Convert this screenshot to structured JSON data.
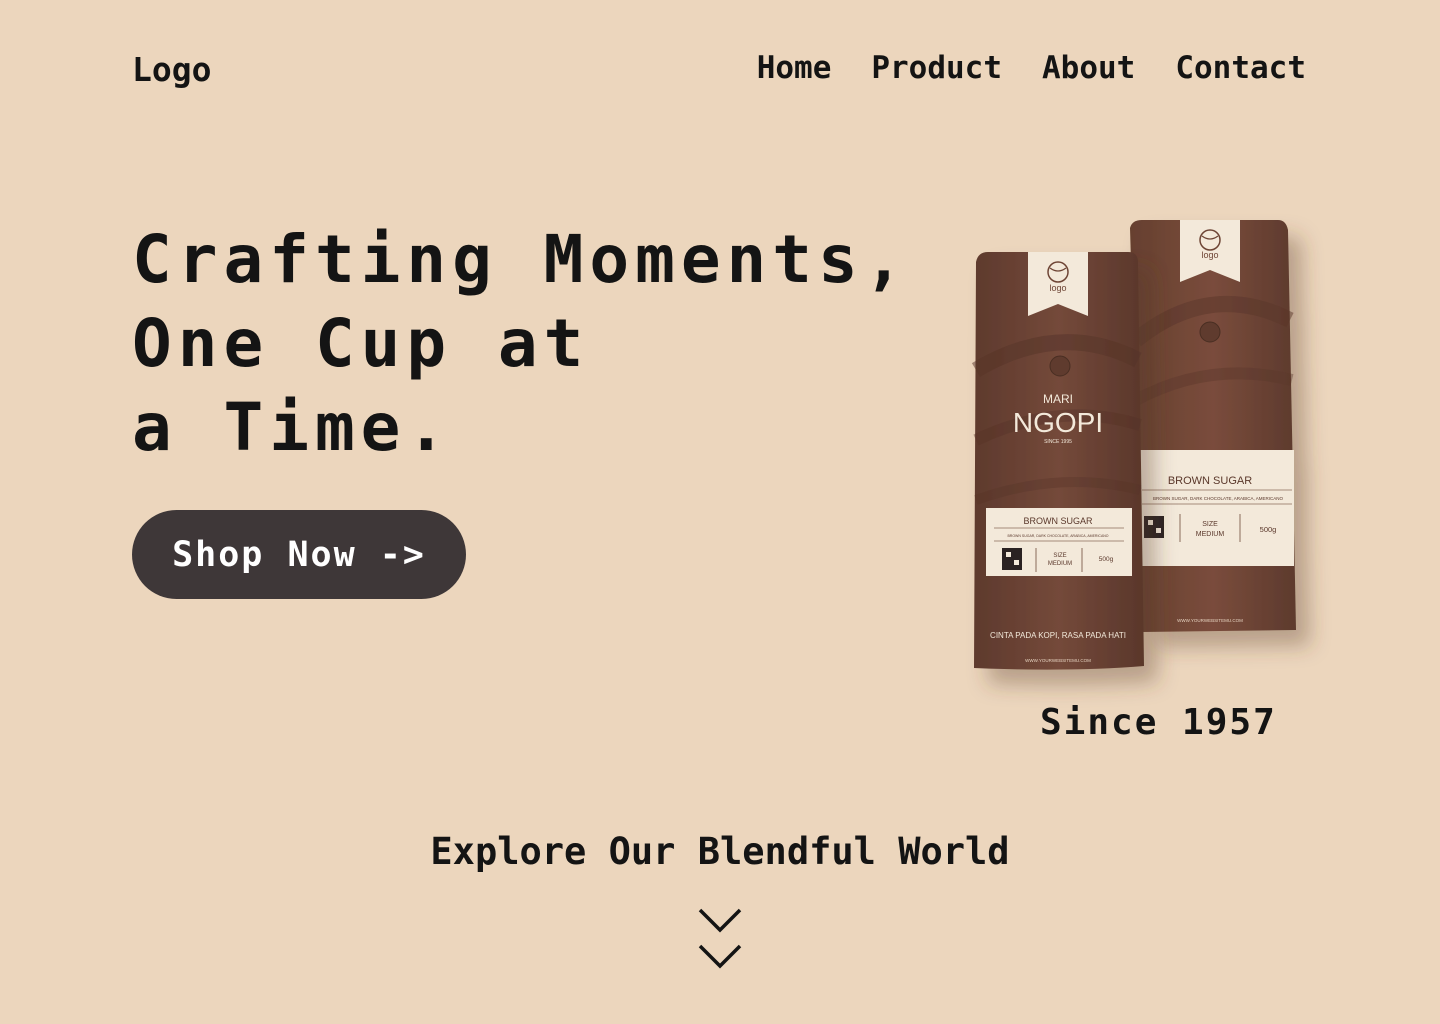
{
  "header": {
    "logo_text": "Logo",
    "nav": [
      {
        "label": "Home"
      },
      {
        "label": "Product"
      },
      {
        "label": "About"
      },
      {
        "label": "Contact"
      }
    ]
  },
  "hero": {
    "title_lines": [
      "Crafting Moments,",
      "One Cup at",
      "a Time."
    ],
    "cta_label": "Shop Now ->"
  },
  "product": {
    "front_bag": {
      "brand_small": "logo",
      "brand_top": "MARI",
      "brand_name": "NGOPI",
      "since_small": "SINCE 1995",
      "flavor": "BROWN SUGAR",
      "notes": "BROWN SUGAR, DARK CHOCOLATE, ARABICA, AMERICANO",
      "size_label": "SIZE",
      "size_value": "MEDIUM",
      "weight": "500g",
      "tagline": "CINTA PADA KOPI, RASA PADA HATI",
      "website": "WWW.YOURWEBSITEMU.COM"
    },
    "back_bag": {
      "brand_small": "logo",
      "flavor": "BROWN SUGAR",
      "notes": "BROWN SUGAR, DARK CHOCOLATE, ARABICA, AMERICANO",
      "size_label": "SIZE",
      "size_value": "MEDIUM",
      "weight": "500g",
      "website": "WWW.YOURWEBSITEMU.COM"
    },
    "since_caption": "Since 1957"
  },
  "explore": {
    "title": "Explore Our Blendful World",
    "scroll_icon": "double-chevron-down-icon"
  },
  "colors": {
    "background": "#ecd6bd",
    "text": "#141414",
    "button_bg": "#3e3738",
    "button_text": "#ffffff",
    "bag_brown": "#6e4536",
    "label_cream": "#f3e9da"
  }
}
